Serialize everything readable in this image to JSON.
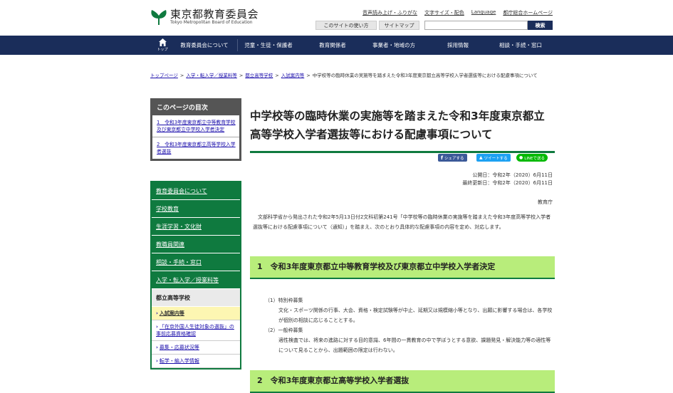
{
  "header": {
    "logo_main": "東京都教育委員会",
    "logo_sub": "Tokyo Metropolitan Board of Education",
    "util_links": [
      "音声読み上げ・ふりがな",
      "文字サイズ・配色",
      "Language",
      "都庁総合ホームページ"
    ],
    "usage_button": "このサイトの使い方",
    "sitemap_button": "サイトマップ",
    "search_placeholder": "",
    "search_button": "検索"
  },
  "nav": {
    "home_label": "トップ",
    "items": [
      "教育委員会について",
      "児童・生徒・保護者",
      "教育関係者",
      "事業者・地域の方",
      "採用情報",
      "相談・手続・窓口"
    ]
  },
  "breadcrumb": {
    "links": [
      "トップページ",
      "入学・転入学／授業料等",
      "都立高等学校",
      "入試案内等"
    ],
    "current": "中学校等の臨時休業の実施等を踏まえた令和3年度東京都立高等学校入学者選抜等における配慮事項について"
  },
  "toc": {
    "title": "このページの目次",
    "items": [
      "1　令和3年度東京都立中等教育学校及び東京都立中学校入学者決定",
      "2　令和3年度東京都立高等学校入学者選抜"
    ]
  },
  "menu": {
    "items": [
      "教育委員会について",
      "学校教育",
      "生涯学習・文化財",
      "教職員関連",
      "相談・手続・窓口",
      "入学・転入学／授業料等"
    ],
    "active": "都立高等学校",
    "sub_items": [
      "入試案内等",
      "「在京外国人生徒対象の選抜」の事前応募資格確認",
      "募集・応募状況等",
      "転学・編入学情報"
    ]
  },
  "main": {
    "title": "中学校等の臨時休業の実施等を踏まえた令和3年度東京都立高等学校入学者選抜等における配慮事項について",
    "share": [
      "シェアする",
      "ツイートする",
      "LINEで送る"
    ],
    "published": "公開日：令和2年（2020）6月11日",
    "updated": "最終更新日：令和2年（2020）6月11日",
    "department": "教育庁",
    "intro": "文部科学省から発出された令和2年5月13日付2文科初第241号「中学校等の臨時休業の実施等を踏まえた令和3年度高等学校入学者選抜等における配慮事項について（通知）」を踏まえ、次のとおり具体的な配慮事項の内容を定め、対応します。",
    "section1_title": "1　令和3年度東京都立中等教育学校及び東京都立中学校入学者決定",
    "section1_items": [
      {
        "label": "（1）特別枠募集",
        "body": "文化・スポーツ関係の行事、大会、資格・検定試験等が中止、延期又は規模縮小等となり、出願に影響する場合は、各学校が個別の相談に応じることとする。"
      },
      {
        "label": "（2）一般枠募集",
        "body": "適性検査では、将来の進路に対する目的意識、6年間の一貫教育の中で学ぼうとする意欲、課題発見・解決能力等の適性等について見ることから、出題範囲の限定は行わない。"
      }
    ],
    "section2_title": "2　令和3年度東京都立高等学校入学者選抜"
  },
  "colors": {
    "navy": "#1a2d5a",
    "green": "#0f7a3f",
    "heading_bg": "#b8ed7b",
    "highlight": "#fdf6b2",
    "facebook": "#3b5998",
    "twitter": "#1da1f2",
    "line": "#00b900"
  }
}
